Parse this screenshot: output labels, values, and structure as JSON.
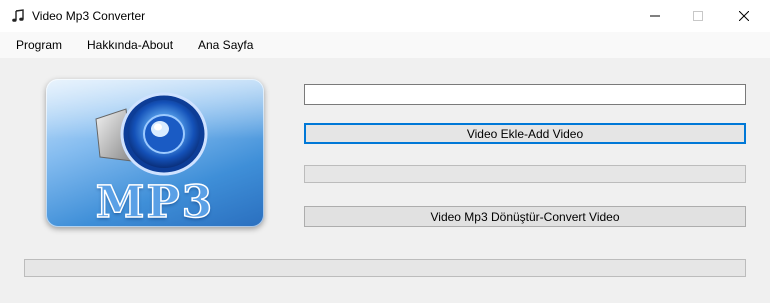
{
  "window": {
    "title": "Video Mp3 Converter",
    "icon": "music-note-icon"
  },
  "menu": {
    "items": [
      {
        "label": "Program"
      },
      {
        "label": "Hakkında-About"
      },
      {
        "label": "Ana Sayfa"
      }
    ]
  },
  "logo": {
    "text": "MP3",
    "icon": "speaker-icon"
  },
  "file_path": {
    "value": "",
    "placeholder": ""
  },
  "buttons": {
    "add_video": "Video Ekle-Add Video",
    "convert": "Video Mp3 Dönüştür-Convert Video"
  },
  "progress": {
    "top_fraction": 0,
    "bottom_fraction": 0
  },
  "colors": {
    "focus_accent": "#0078d7",
    "logo_blue": "#3f8fd8"
  }
}
